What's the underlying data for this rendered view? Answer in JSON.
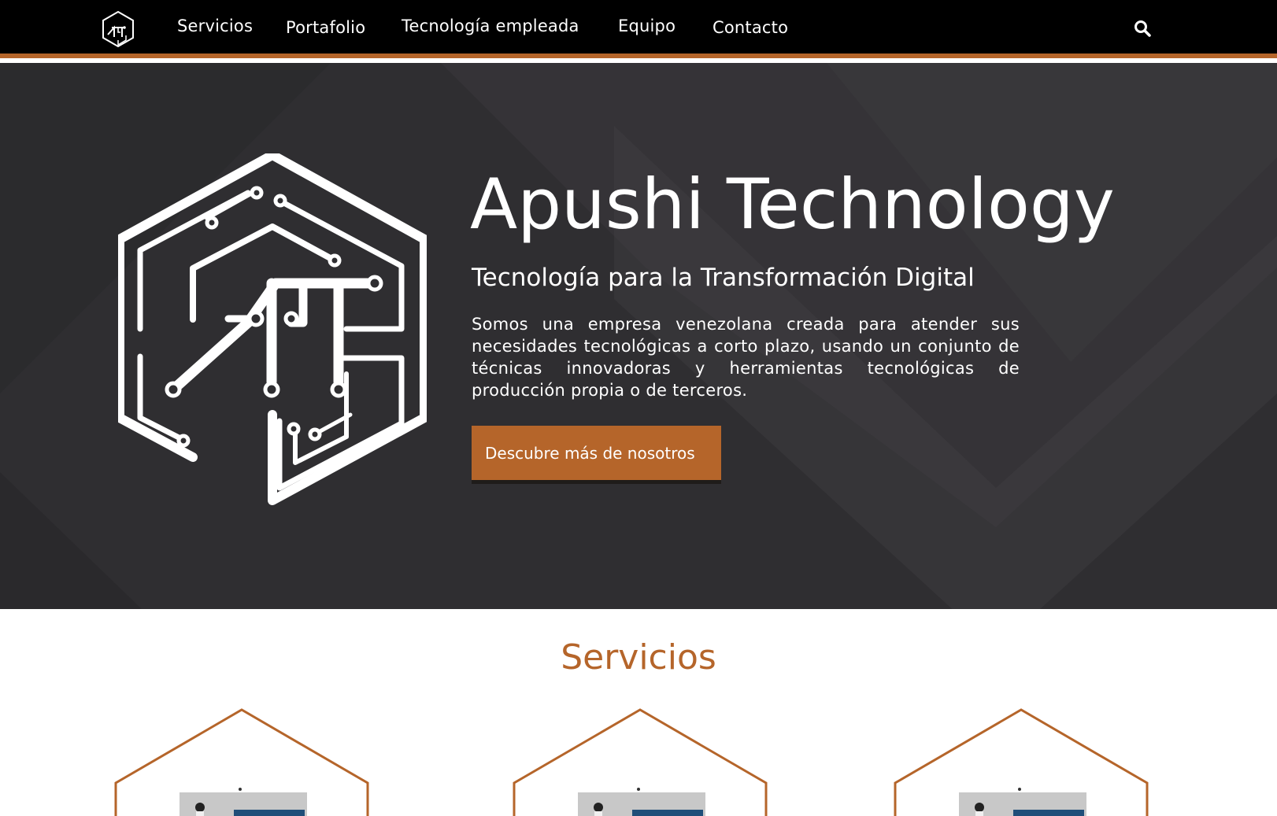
{
  "nav": {
    "items": [
      "Servicios",
      "Portafolio",
      "Tecnología empleada",
      "Equipo",
      "Contacto"
    ],
    "logo_icon": "apushi-logo-icon",
    "search_icon": "search-icon"
  },
  "hero": {
    "title": "Apushi Technology",
    "subtitle": "Tecnología para la Transformación Digital",
    "description": "Somos una empresa venezolana creada para atender sus necesidades tecnológicas a corto plazo, usando un conjunto de técnicas innovadoras y herramientas tecnológicas de producción propia o de terceros.",
    "cta_label": "Descubre más de nosotros"
  },
  "services": {
    "title": "Servicios"
  },
  "colors": {
    "accent": "#b5652a",
    "nav_bg": "#000000",
    "hero_bg": "#2f2e31"
  }
}
